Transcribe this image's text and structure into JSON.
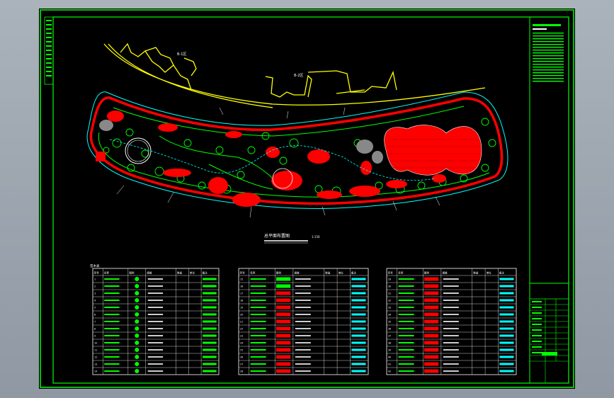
{
  "viewer": {
    "name": "CAD drawing viewer"
  },
  "drawing": {
    "title": "总平面布置图",
    "scale": "1:150",
    "building_labels": [
      "B-1区",
      "B-2区"
    ],
    "legend_title": "苗木表",
    "colors": {
      "background": "#000000",
      "frame": "#00ff00",
      "hatch": "#ff0000",
      "building": "#ffff00",
      "path": "#00ffff",
      "text": "#ffffff"
    }
  },
  "tables": [
    {
      "id": "table-1",
      "header": [
        "序号",
        "名称",
        "图例",
        "规格",
        "数量",
        "单位",
        "备注"
      ],
      "row_count": 14
    },
    {
      "id": "table-2",
      "header": [
        "序号",
        "名称",
        "图例",
        "规格",
        "数量",
        "单位",
        "备注"
      ],
      "row_count": 14
    },
    {
      "id": "table-3",
      "header": [
        "序号",
        "名称",
        "图例",
        "规格",
        "数量",
        "单位",
        "备注"
      ],
      "row_count": 14
    }
  ],
  "title_block": {
    "project_label": "设计说明"
  }
}
